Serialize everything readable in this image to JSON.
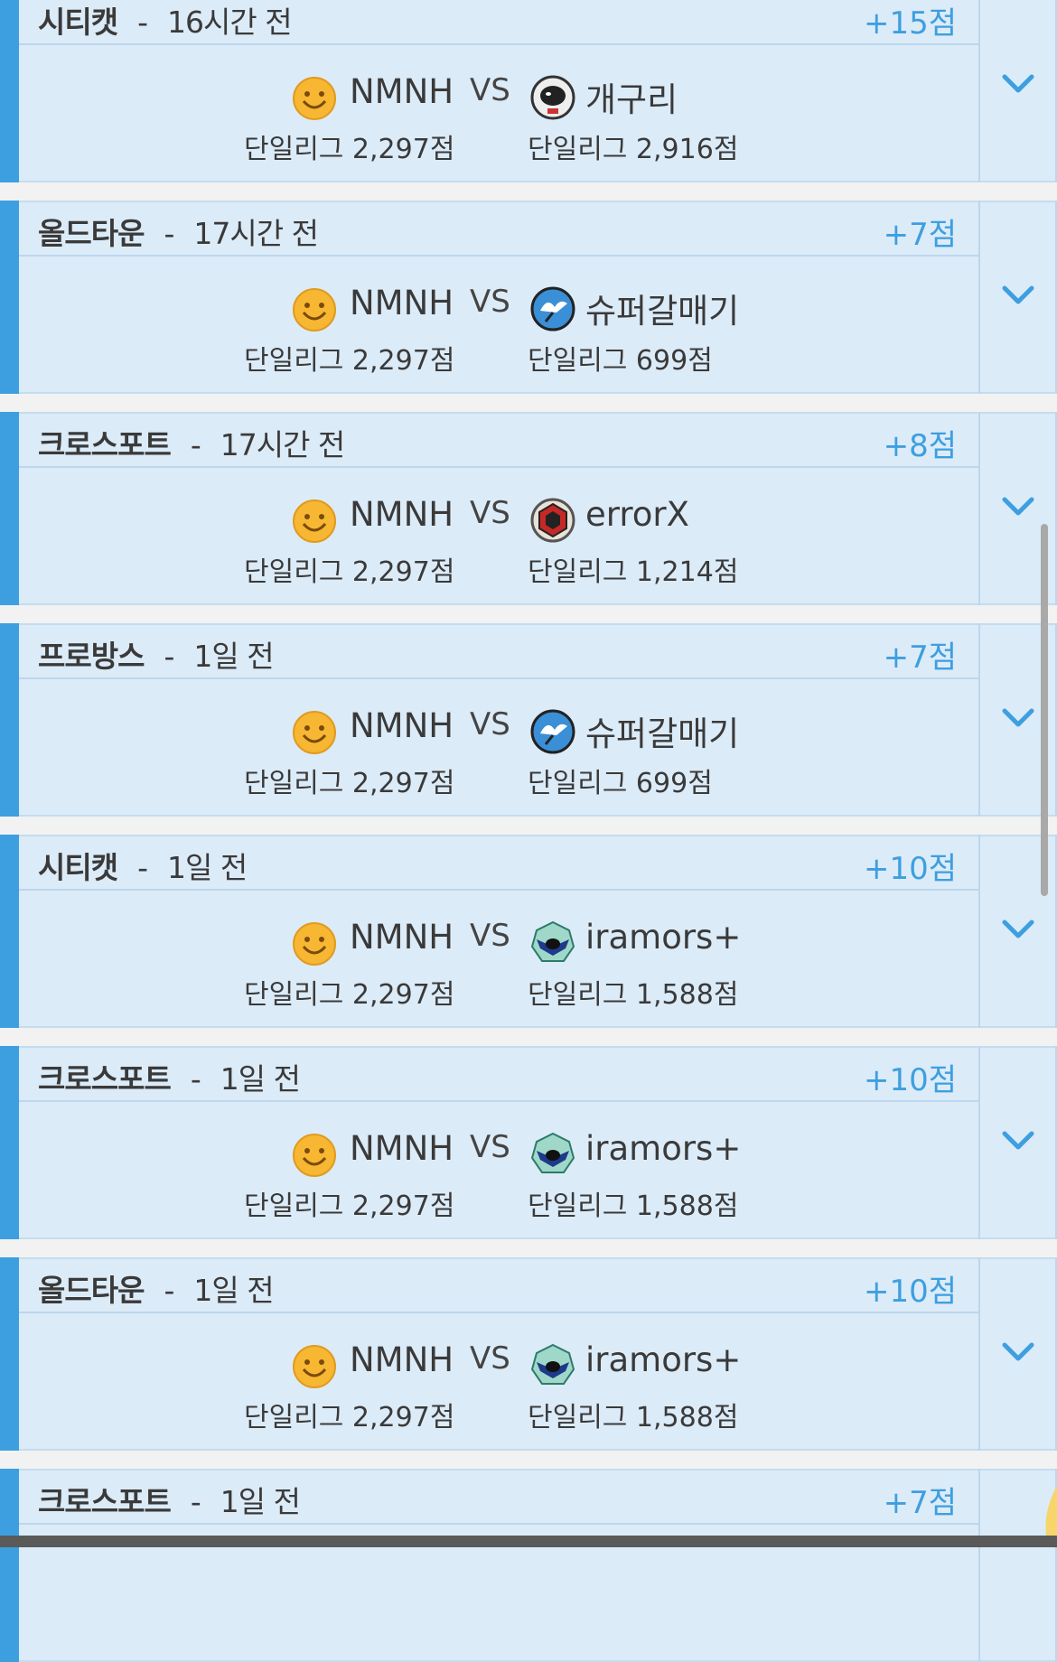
{
  "matches": [
    {
      "map": "시티캣",
      "separator": "-",
      "time": "16시간 전",
      "points": "+15점",
      "player": "NMNH",
      "player_league": "단일리그 2,297점",
      "vs": "VS",
      "opponent": "개구리",
      "opponent_league": "단일리그 2,916점",
      "opponent_avatar": "astronaut-avatar"
    },
    {
      "map": "올드타운",
      "separator": "-",
      "time": "17시간 전",
      "points": "+7점",
      "player": "NMNH",
      "player_league": "단일리그 2,297점",
      "vs": "VS",
      "opponent": "슈퍼갈매기",
      "opponent_league": "단일리그 699점",
      "opponent_avatar": "seagull-avatar"
    },
    {
      "map": "크로스포트",
      "separator": "-",
      "time": "17시간 전",
      "points": "+8점",
      "player": "NMNH",
      "player_league": "단일리그 2,297점",
      "vs": "VS",
      "opponent": "errorX",
      "opponent_league": "단일리그 1,214점",
      "opponent_avatar": "hexagon-avatar"
    },
    {
      "map": "프로방스",
      "separator": "-",
      "time": "1일 전",
      "points": "+7점",
      "player": "NMNH",
      "player_league": "단일리그 2,297점",
      "vs": "VS",
      "opponent": "슈퍼갈매기",
      "opponent_league": "단일리그 699점",
      "opponent_avatar": "seagull-avatar"
    },
    {
      "map": "시티캣",
      "separator": "-",
      "time": "1일 전",
      "points": "+10점",
      "player": "NMNH",
      "player_league": "단일리그 2,297점",
      "vs": "VS",
      "opponent": "iramors+",
      "opponent_league": "단일리그 1,588점",
      "opponent_avatar": "emblem-avatar"
    },
    {
      "map": "크로스포트",
      "separator": "-",
      "time": "1일 전",
      "points": "+10점",
      "player": "NMNH",
      "player_league": "단일리그 2,297점",
      "vs": "VS",
      "opponent": "iramors+",
      "opponent_league": "단일리그 1,588점",
      "opponent_avatar": "emblem-avatar"
    },
    {
      "map": "올드타운",
      "separator": "-",
      "time": "1일 전",
      "points": "+10점",
      "player": "NMNH",
      "player_league": "단일리그 2,297점",
      "vs": "VS",
      "opponent": "iramors+",
      "opponent_league": "단일리그 1,588점",
      "opponent_avatar": "emblem-avatar"
    },
    {
      "map": "크로스포트",
      "separator": "-",
      "time": "1일 전",
      "points": "+7점"
    }
  ],
  "colors": {
    "accent": "#3d9fe0",
    "card_bg": "#dcebf8",
    "points": "#3d9fe0"
  },
  "icons": {
    "expand": "chevron-down-icon",
    "player_avatar": "smiley-avatar"
  }
}
